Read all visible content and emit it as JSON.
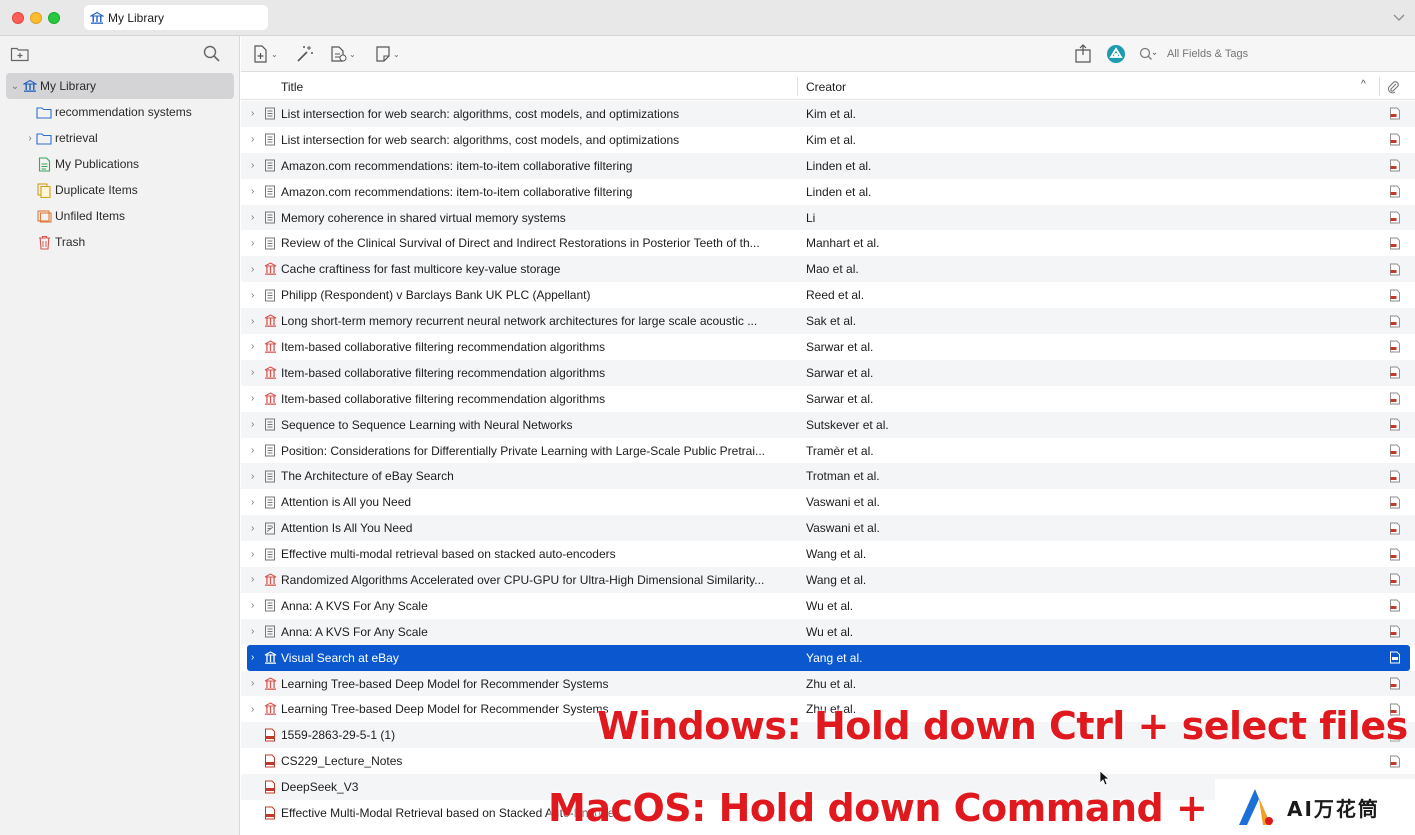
{
  "window": {
    "tab_title": "My Library"
  },
  "sidebar": {
    "items": [
      {
        "label": "My Library",
        "icon": "library-icon"
      },
      {
        "label": "recommendation systems",
        "icon": "folder-icon"
      },
      {
        "label": "retrieval",
        "icon": "folder-icon"
      },
      {
        "label": "My Publications",
        "icon": "publications-icon"
      },
      {
        "label": "Duplicate Items",
        "icon": "duplicate-icon"
      },
      {
        "label": "Unfiled Items",
        "icon": "unfiled-icon"
      },
      {
        "label": "Trash",
        "icon": "trash-icon"
      }
    ]
  },
  "toolbar": {
    "search_placeholder": "All Fields & Tags"
  },
  "columns": {
    "title": "Title",
    "creator": "Creator"
  },
  "items": [
    {
      "title": "List intersection for web search: algorithms, cost models, and optimizations",
      "creator": "Kim et al.",
      "type": "document",
      "expandable": true
    },
    {
      "title": "List intersection for web search: algorithms, cost models, and optimizations",
      "creator": "Kim et al.",
      "type": "document",
      "expandable": true
    },
    {
      "title": "Amazon.com recommendations: item-to-item collaborative filtering",
      "creator": "Linden et al.",
      "type": "document",
      "expandable": true
    },
    {
      "title": "Amazon.com recommendations: item-to-item collaborative filtering",
      "creator": "Linden et al.",
      "type": "document",
      "expandable": true
    },
    {
      "title": "Memory coherence in shared virtual memory systems",
      "creator": "Li",
      "type": "document",
      "expandable": true
    },
    {
      "title": "Review of the Clinical Survival of Direct and Indirect Restorations in Posterior Teeth of th...",
      "creator": "Manhart et al.",
      "type": "document",
      "expandable": true
    },
    {
      "title": "Cache craftiness for fast multicore key-value storage",
      "creator": "Mao et al.",
      "type": "conference",
      "expandable": true
    },
    {
      "title": "Philipp (Respondent) v Barclays Bank UK PLC (Appellant)",
      "creator": "Reed et al.",
      "type": "document",
      "expandable": true
    },
    {
      "title": "Long short-term memory recurrent neural network architectures for large scale acoustic ...",
      "creator": "Sak et al.",
      "type": "conference",
      "expandable": true
    },
    {
      "title": "Item-based collaborative filtering recommendation algorithms",
      "creator": "Sarwar et al.",
      "type": "conference",
      "expandable": true
    },
    {
      "title": "Item-based collaborative filtering recommendation algorithms",
      "creator": "Sarwar et al.",
      "type": "conference",
      "expandable": true
    },
    {
      "title": "Item-based collaborative filtering recommendation algorithms",
      "creator": "Sarwar et al.",
      "type": "conference",
      "expandable": true
    },
    {
      "title": "Sequence to Sequence Learning with Neural Networks",
      "creator": "Sutskever et al.",
      "type": "document",
      "expandable": true
    },
    {
      "title": "Position: Considerations for Differentially Private Learning with Large-Scale Public Pretrai...",
      "creator": "Tramèr et al.",
      "type": "document",
      "expandable": true
    },
    {
      "title": "The Architecture of eBay Search",
      "creator": "Trotman et al.",
      "type": "document",
      "expandable": true
    },
    {
      "title": "Attention is All you Need",
      "creator": "Vaswani et al.",
      "type": "document",
      "expandable": true
    },
    {
      "title": "Attention Is All You Need",
      "creator": "Vaswani et al.",
      "type": "preprint",
      "expandable": true
    },
    {
      "title": "Effective multi-modal retrieval based on stacked auto-encoders",
      "creator": "Wang et al.",
      "type": "document",
      "expandable": true
    },
    {
      "title": "Randomized Algorithms Accelerated over CPU-GPU for Ultra-High Dimensional Similarity...",
      "creator": "Wang et al.",
      "type": "conference",
      "expandable": true
    },
    {
      "title": "Anna: A KVS For Any Scale",
      "creator": "Wu et al.",
      "type": "document",
      "expandable": true
    },
    {
      "title": "Anna: A KVS For Any Scale",
      "creator": "Wu et al.",
      "type": "document",
      "expandable": true
    },
    {
      "title": "Visual Search at eBay",
      "creator": "Yang et al.",
      "type": "conference",
      "expandable": true,
      "selected": true
    },
    {
      "title": "Learning Tree-based Deep Model for Recommender Systems",
      "creator": "Zhu et al.",
      "type": "conference",
      "expandable": true
    },
    {
      "title": "Learning Tree-based Deep Model for Recommender Systems",
      "creator": "Zhu et al.",
      "type": "conference",
      "expandable": true
    },
    {
      "title": "1559-2863-29-5-1 (1)",
      "creator": "",
      "type": "pdf",
      "expandable": false
    },
    {
      "title": "CS229_Lecture_Notes",
      "creator": "",
      "type": "pdf",
      "expandable": false
    },
    {
      "title": "DeepSeek_V3",
      "creator": "",
      "type": "pdf",
      "expandable": false
    },
    {
      "title": "Effective Multi-Modal Retrieval based on Stacked Auto-Encoder",
      "creator": "",
      "type": "pdf",
      "expandable": false
    }
  ],
  "overlay": {
    "windows_caption": "Windows: Hold down Ctrl + select files",
    "mac_caption": "MacOS: Hold down Command + se",
    "watermark": "AI万花筒"
  },
  "colors": {
    "selection": "#0b57d0",
    "caption": "#e0191f",
    "pdf": "#c0392b"
  }
}
